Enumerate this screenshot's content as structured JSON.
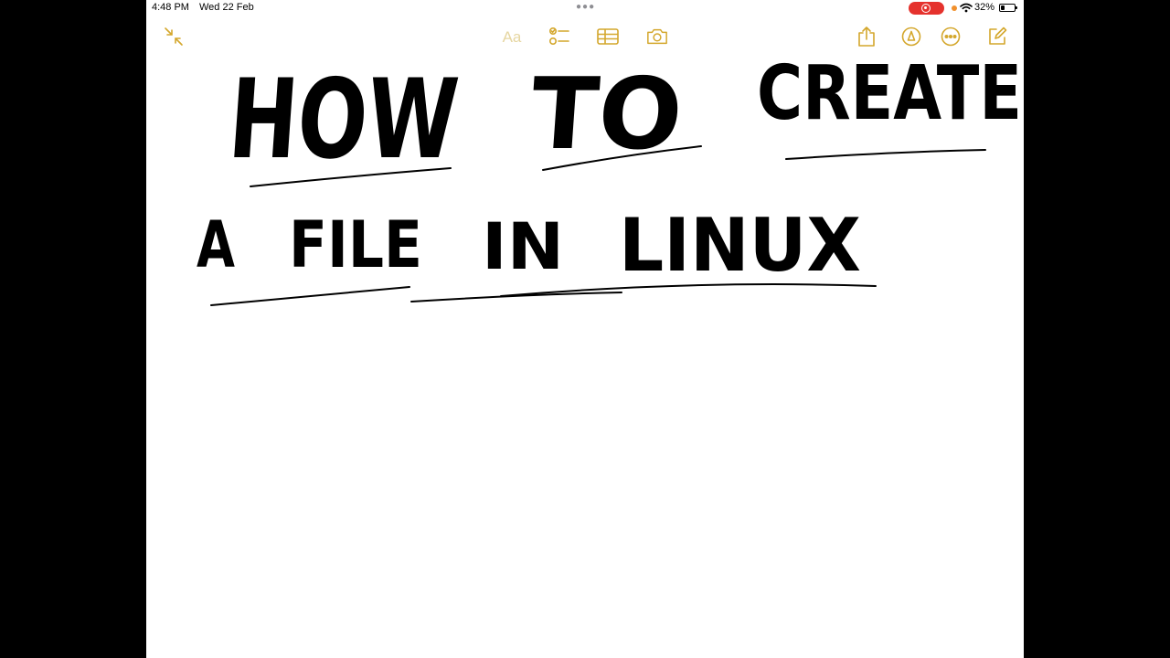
{
  "status_bar": {
    "time": "4:48 PM",
    "date": "Wed 22 Feb",
    "battery_percent": "32%",
    "battery_level": 0.32,
    "recording_color": "#e5322d"
  },
  "toolbar": {
    "accent_color": "#d4a72c",
    "format_label": "Aa",
    "icons": [
      "collapse-icon",
      "checklist-icon",
      "table-icon",
      "camera-icon",
      "share-icon",
      "markup-pen-icon",
      "more-icon",
      "compose-icon"
    ]
  },
  "note": {
    "line1_words": [
      "HOW",
      "TO",
      "CREATE"
    ],
    "line2_words": [
      "A",
      "FILE",
      "IN",
      "LINUX"
    ],
    "ink_color": "#000000"
  }
}
